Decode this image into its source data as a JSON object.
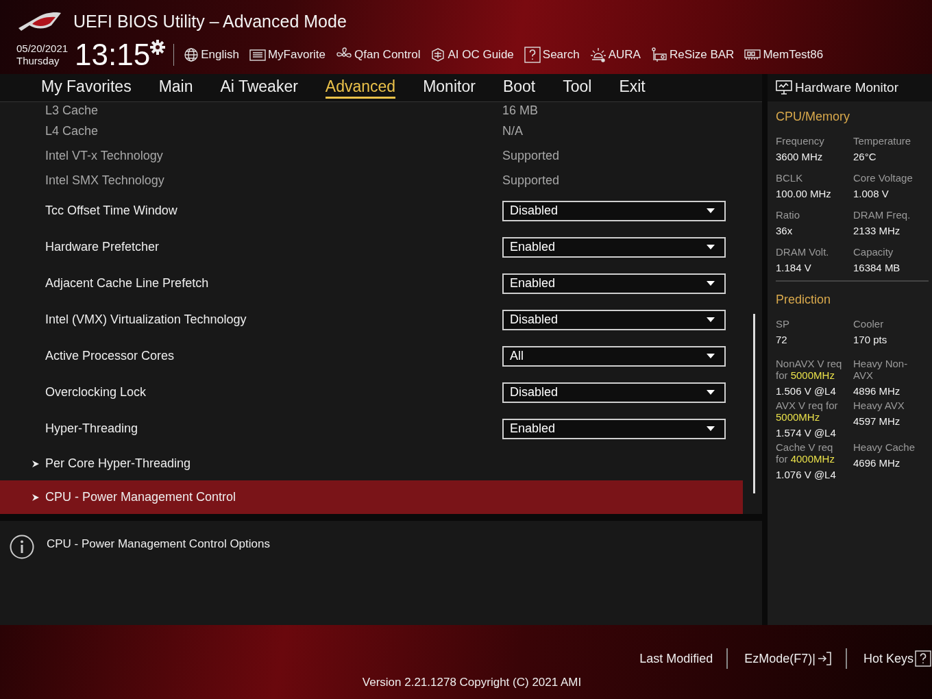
{
  "header": {
    "title": "UEFI BIOS Utility – Advanced Mode",
    "date": "05/20/2021",
    "day": "Thursday",
    "time": "13:15",
    "tools": [
      {
        "kind": "globe",
        "label": "English"
      },
      {
        "kind": "list",
        "label": "MyFavorite"
      },
      {
        "kind": "fan",
        "label": "Qfan Control"
      },
      {
        "kind": "chip",
        "label": "AI OC Guide"
      },
      {
        "kind": "help",
        "label": "Search"
      },
      {
        "kind": "light",
        "label": "AURA"
      },
      {
        "kind": "card",
        "label": "ReSize BAR"
      },
      {
        "kind": "memory",
        "label": "MemTest86"
      }
    ]
  },
  "tabs": [
    {
      "label": "My Favorites",
      "selected": false
    },
    {
      "label": "Main",
      "selected": false
    },
    {
      "label": "Ai Tweaker",
      "selected": false
    },
    {
      "label": "Advanced",
      "selected": true
    },
    {
      "label": "Monitor",
      "selected": false
    },
    {
      "label": "Boot",
      "selected": false
    },
    {
      "label": "Tool",
      "selected": false
    },
    {
      "label": "Exit",
      "selected": false
    }
  ],
  "settings": [
    {
      "kind": "info",
      "label": "L3 Cache",
      "value": "16 MB"
    },
    {
      "kind": "info",
      "label": "L4 Cache",
      "value": "N/A"
    },
    {
      "kind": "info",
      "label": "Intel VT-x Technology",
      "value": "Supported"
    },
    {
      "kind": "info",
      "label": "Intel SMX Technology",
      "value": "Supported"
    },
    {
      "kind": "dropdown",
      "label": "Tcc Offset Time Window",
      "value": "Disabled"
    },
    {
      "kind": "dropdown",
      "label": "Hardware Prefetcher",
      "value": "Enabled"
    },
    {
      "kind": "dropdown",
      "label": "Adjacent Cache Line Prefetch",
      "value": "Enabled"
    },
    {
      "kind": "dropdown",
      "label": "Intel (VMX) Virtualization Technology",
      "value": "Disabled"
    },
    {
      "kind": "dropdown",
      "label": "Active Processor Cores",
      "value": "All"
    },
    {
      "kind": "dropdown",
      "label": "Overclocking Lock",
      "value": "Disabled"
    },
    {
      "kind": "dropdown",
      "label": "Hyper-Threading",
      "value": "Enabled"
    },
    {
      "kind": "submenu",
      "label": "Per Core Hyper-Threading",
      "selected": false
    },
    {
      "kind": "submenu",
      "label": "CPU - Power Management Control",
      "selected": true
    }
  ],
  "help": {
    "text": "CPU - Power Management Control Options"
  },
  "hardware_monitor": {
    "title": "Hardware Monitor",
    "sections": [
      {
        "title": "CPU/Memory",
        "items": [
          {
            "label": "Frequency",
            "value": "3600 MHz"
          },
          {
            "label": "Temperature",
            "value": "26°C"
          },
          {
            "label": "BCLK",
            "value": "100.00 MHz"
          },
          {
            "label": "Core Voltage",
            "value": "1.008 V"
          },
          {
            "label": "Ratio",
            "value": "36x"
          },
          {
            "label": "DRAM Freq.",
            "value": "2133 MHz"
          },
          {
            "label": "DRAM Volt.",
            "value": "1.184 V"
          },
          {
            "label": "Capacity",
            "value": "16384 MB"
          }
        ]
      },
      {
        "title": "Prediction",
        "items": [
          {
            "label": "SP",
            "value": "72"
          },
          {
            "label": "Cooler",
            "value": "170 pts"
          },
          {
            "label": "NonAVX V req for **5000MHz**",
            "value": "1.506 V @L4"
          },
          {
            "label": "Heavy Non-AVX",
            "value": "4896 MHz"
          },
          {
            "label": "AVX V req    for **5000MHz**",
            "value": "1.574 V @L4"
          },
          {
            "label": "Heavy AVX",
            "value": "4597 MHz"
          },
          {
            "label": "Cache V req for **4000MHz**",
            "value": "1.076 V @L4"
          },
          {
            "label": "Heavy Cache",
            "value": "4696 MHz"
          }
        ]
      }
    ]
  },
  "footer": {
    "buttons": [
      {
        "kind": "plain",
        "label": "Last Modified"
      },
      {
        "kind": "exit",
        "label": "EzMode(F7)|"
      },
      {
        "kind": "help",
        "label": "Hot Keys"
      }
    ],
    "version": "Version 2.21.1278 Copyright (C) 2021 AMI"
  }
}
